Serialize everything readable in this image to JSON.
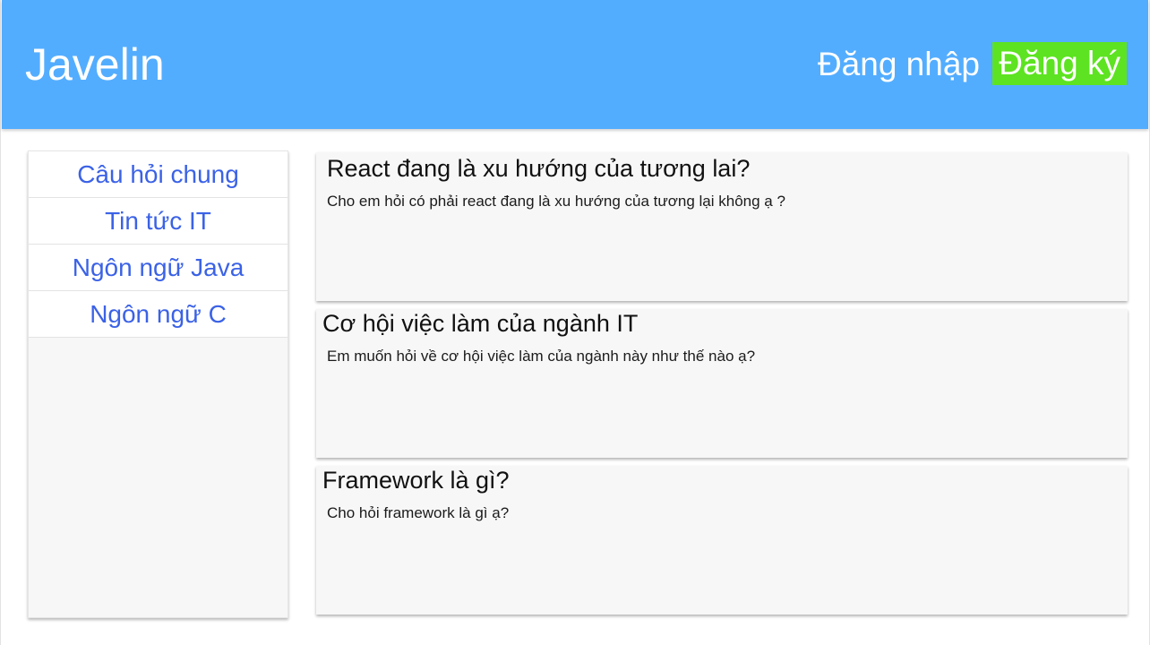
{
  "header": {
    "brand": "Javelin",
    "login_label": "Đăng nhập",
    "register_label": "Đăng ký",
    "colors": {
      "background": "#53adff",
      "register_bg": "#5de321"
    }
  },
  "sidebar": {
    "items": [
      {
        "label": "Câu hỏi chung"
      },
      {
        "label": "Tin tức IT"
      },
      {
        "label": "Ngôn ngữ Java"
      },
      {
        "label": "Ngôn ngữ C"
      }
    ],
    "colors": {
      "link": "#3b62e6"
    }
  },
  "posts": [
    {
      "title": "React đang là xu hướng của tương lai?",
      "body": "Cho em hỏi có phải react đang là xu hướng của tương lại không ạ ?"
    },
    {
      "title": "Cơ hội việc làm của ngành IT",
      "body": "Em muốn hỏi về cơ hội việc làm của ngành này như thế nào ạ?"
    },
    {
      "title": "Framework là gì?",
      "body": "Cho hỏi framework là gì ạ?"
    }
  ]
}
